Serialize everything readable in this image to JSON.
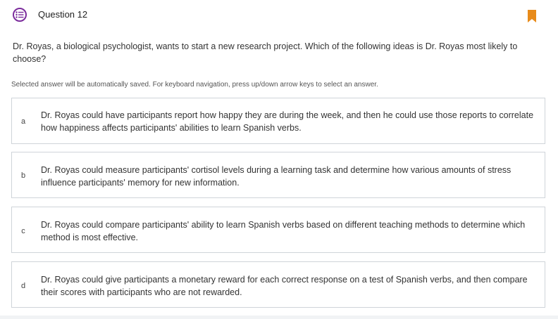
{
  "question": {
    "title": "Question 12",
    "prompt": "Dr. Royas, a biological psychologist, wants to start a new research project. Which of the following ideas is Dr. Royas most likely to choose?",
    "instruction": "Selected answer will be automatically saved. For keyboard navigation, press up/down arrow keys to select an answer."
  },
  "icons": {
    "question_icon": "list-circle-icon",
    "bookmark_icon": "bookmark-icon"
  },
  "colors": {
    "accent_purple": "#7b2c9c",
    "bookmark_orange": "#e88b1a",
    "border": "#cfd4d9"
  },
  "answers": [
    {
      "letter": "a",
      "text": "Dr. Royas could have participants report how happy they are during the week, and then he could use those reports to correlate how happiness affects participants' abilities to learn Spanish verbs."
    },
    {
      "letter": "b",
      "text": "Dr. Royas could measure participants' cortisol levels during a learning task and determine how various amounts of stress influence participants' memory for new information."
    },
    {
      "letter": "c",
      "text": "Dr. Royas could compare participants' ability to learn Spanish verbs based on different teaching methods to determine which method is most effective."
    },
    {
      "letter": "d",
      "text": "Dr. Royas could give participants a monetary reward for each correct response on a test of Spanish verbs, and then compare their scores with participants who are not rewarded."
    }
  ]
}
